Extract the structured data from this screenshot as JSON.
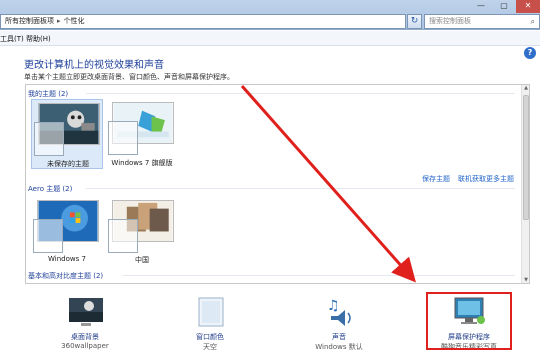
{
  "address": {
    "crumbs": [
      "所有控制面板项",
      "个性化"
    ],
    "separator": "▸"
  },
  "search": {
    "placeholder": "搜索控制面板"
  },
  "window_buttons": {
    "min": "—",
    "max": "▢",
    "close": "✕"
  },
  "menu": [
    {
      "label": "工具(T)"
    },
    {
      "label": "帮助(H)"
    }
  ],
  "help_glyph": "?",
  "refresh_glyph": "↻",
  "search_glyph": "⌕",
  "heading": "更改计算机上的视觉效果和声音",
  "subtext": "单击某个主题立即更改桌面背景、窗口颜色、声音和屏幕保护程序。",
  "groups": {
    "my": {
      "label": "我的主题 (2)",
      "themes": [
        {
          "label": "未保存的主题",
          "selected": true
        },
        {
          "label": "Windows 7 旗舰版",
          "selected": false
        }
      ],
      "links": [
        "保存主题",
        "联机获取更多主题"
      ]
    },
    "aero": {
      "label": "Aero 主题 (2)",
      "themes": [
        {
          "label": "Windows 7"
        },
        {
          "label": "中国"
        }
      ]
    },
    "basic": {
      "label": "基本和高对比度主题 (2)"
    }
  },
  "bottom": [
    {
      "title": "桌面背景",
      "sub": "360wallpaper",
      "icon": "wallpaper-icon"
    },
    {
      "title": "窗口颜色",
      "sub": "天空",
      "icon": "window-color-icon"
    },
    {
      "title": "声音",
      "sub": "Windows 默认",
      "icon": "sound-icon"
    },
    {
      "title": "屏幕保护程序",
      "sub": "酷狗音乐精彩写真",
      "icon": "screensaver-icon"
    }
  ],
  "colors": {
    "annotation": "#e0201c",
    "link": "#1f63c9",
    "heading": "#1e3f9a",
    "selected": "#dce9f8"
  }
}
